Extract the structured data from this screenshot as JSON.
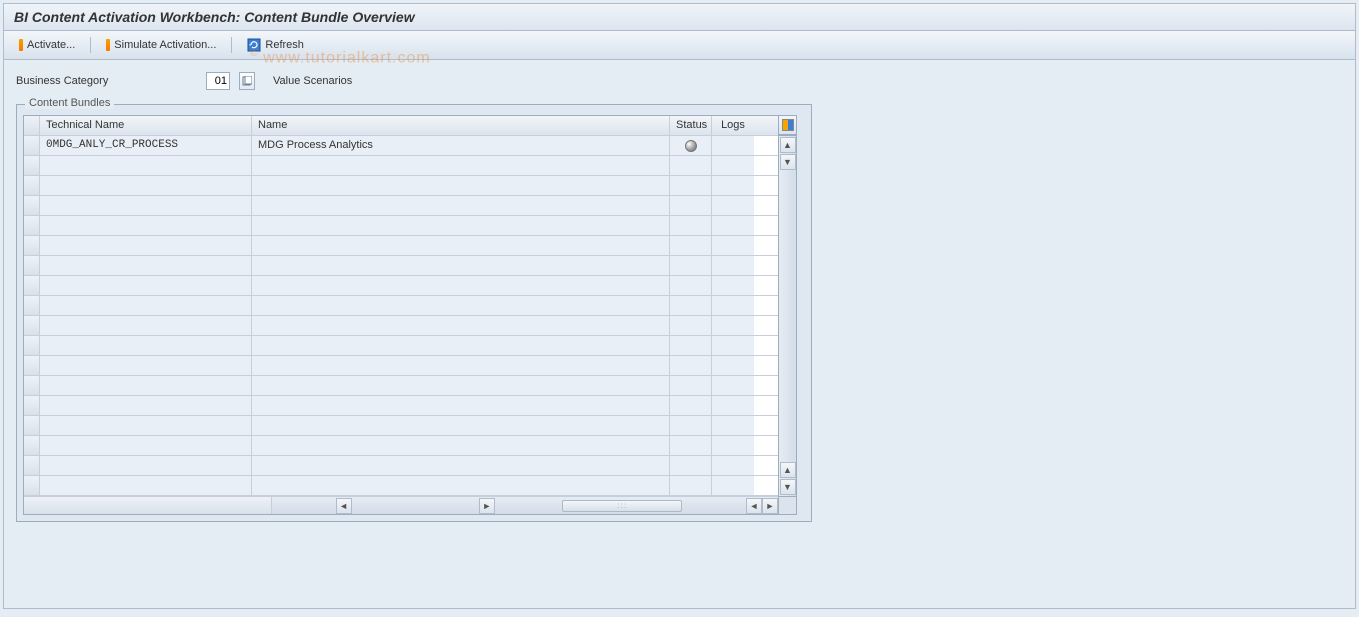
{
  "header": {
    "title": "BI Content Activation Workbench: Content Bundle Overview"
  },
  "toolbar": {
    "activate_label": "Activate...",
    "simulate_label": "Simulate Activation...",
    "refresh_label": "Refresh"
  },
  "filter": {
    "label": "Business Category",
    "value": "01",
    "description": "Value Scenarios"
  },
  "panel": {
    "title": "Content Bundles",
    "columns": {
      "technical_name": "Technical Name",
      "name": "Name",
      "status": "Status",
      "logs": "Logs"
    },
    "rows": [
      {
        "technical_name": "0MDG_ANLY_CR_PROCESS",
        "name": "MDG Process Analytics",
        "status": "inactive",
        "logs": ""
      }
    ],
    "empty_row_count": 17
  },
  "watermark": {
    "text": "www.tutorialkart.com",
    "copyright": "©"
  }
}
